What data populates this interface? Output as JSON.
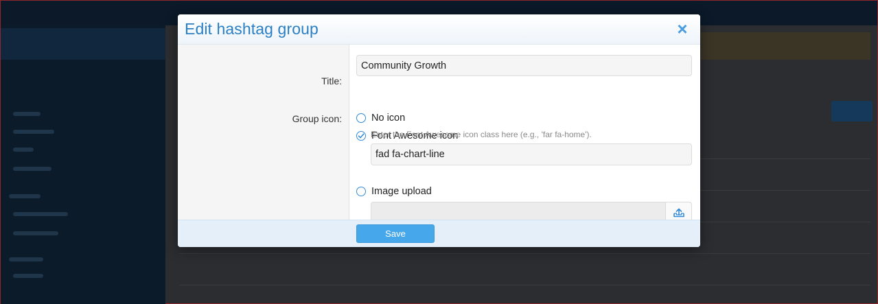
{
  "dialog": {
    "title": "Edit hashtag group",
    "close_symbol": "×",
    "fields": {
      "title_label": "Title:",
      "title_value": "Community Growth",
      "group_icon_label": "Group icon:"
    },
    "icon_options": [
      {
        "label": "No icon",
        "selected": false
      },
      {
        "label": "Font Awesome icon",
        "selected": true
      },
      {
        "label": "Image upload",
        "selected": false
      }
    ],
    "fa_hint": "Enter the Font Awesome icon class here (e.g., 'far fa-home').",
    "fa_value": "fad fa-chart-line",
    "image_upload_value": "",
    "save_label": "Save"
  },
  "icons": {
    "close": "close-icon",
    "upload": "upload-icon",
    "radio_checked": "check-icon"
  },
  "colors": {
    "accent": "#2a7fc4",
    "save_button": "#47a7eb",
    "footer": "#e4eff9"
  }
}
